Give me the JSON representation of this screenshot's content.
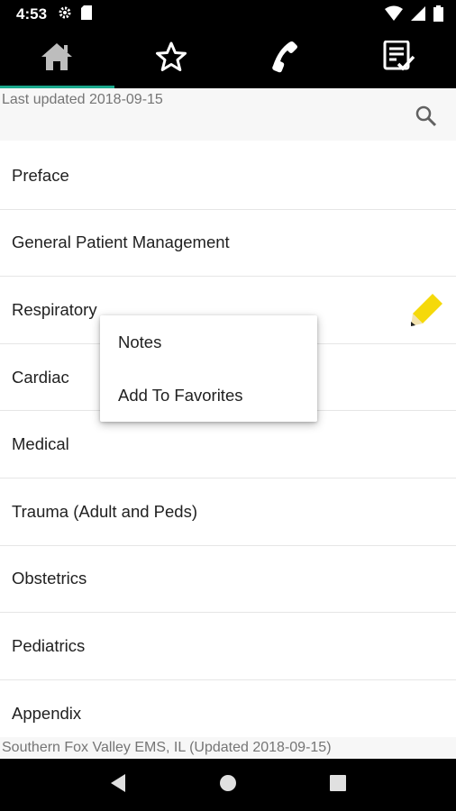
{
  "status_bar": {
    "time": "4:53",
    "icons_left": [
      "gear-icon",
      "sd-card-icon"
    ],
    "icons_right": [
      "wifi-icon",
      "cell-signal-icon",
      "battery-icon"
    ]
  },
  "tabs": [
    {
      "icon": "home-icon",
      "active": true
    },
    {
      "icon": "star-icon",
      "active": false
    },
    {
      "icon": "phone-icon",
      "active": false
    },
    {
      "icon": "checklist-icon",
      "active": false
    }
  ],
  "header": {
    "last_updated": "Last updated 2018-09-15",
    "search_icon": "search-icon"
  },
  "list": {
    "items": [
      "Preface",
      "General Patient Management",
      "Respiratory",
      "Cardiac",
      "Medical",
      "Trauma (Adult and Peds)",
      "Obstetrics",
      "Pediatrics",
      "Appendix"
    ]
  },
  "popup_menu": {
    "items": [
      "Notes",
      "Add To Favorites"
    ]
  },
  "footer": {
    "text": "Southern Fox Valley EMS, IL (Updated 2018-09-15)"
  },
  "colors": {
    "accent": "#1aa88c",
    "pencil": "#f5d90a",
    "bar": "#000000"
  }
}
